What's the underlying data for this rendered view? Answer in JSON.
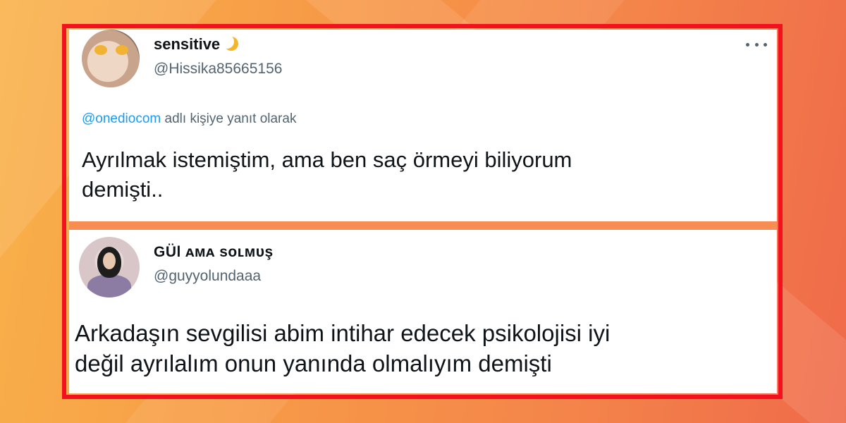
{
  "tweets": [
    {
      "display_name": "sensitive",
      "name_emoji_icon": "crescent-moon-icon",
      "handle": "@Hissika85665156",
      "reply_mention": "@onediocom",
      "reply_suffix": " adlı kişiye yanıt olarak",
      "text_line1": "Ayrılmak istemiştim, ama ben saç örmeyi biliyorum",
      "text_line2": "demişti.."
    },
    {
      "display_name": "GÜl ᴀᴍᴀ sᴏʟᴍᴜş",
      "handle": "@guyyolundaaa",
      "text_line1": "Arkadaşın sevgilisi abim intihar edecek psikolojisi iyi",
      "text_line2": "değil ayrılalım onun yanında olmalıyım demişti"
    }
  ],
  "colors": {
    "frame": "#f2121f",
    "mention": "#1d9bf0",
    "handle": "#536471",
    "text": "#0f1419"
  }
}
